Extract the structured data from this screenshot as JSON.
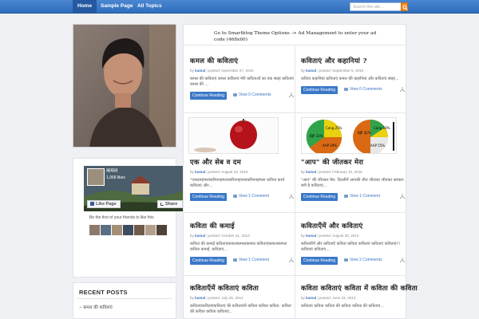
{
  "nav": {
    "items": [
      "Home",
      "Sample Page",
      "All Topics"
    ],
    "search_placeholder": "Search this site..."
  },
  "sidebar": {
    "facebook": {
      "page_name": "कमल",
      "likes": "1,068 likes",
      "like_button": "Like Page",
      "share_button": "Share",
      "friends_text": "Be the first of your friends to like this"
    },
    "recent_posts": {
      "title": "RECENT POSTS",
      "items": [
        "कमल की कविताएं"
      ]
    }
  },
  "main": {
    "ad_text": "Go to Smartblog Theme Options -> Ad Management to enter your ad code (468x60)",
    "continue_label": "Continue Reading",
    "posts": [
      {
        "title": "कमल की कविताएं",
        "author": "kamal",
        "posted": " | posted: November 27, 2015",
        "excerpt": "कमल की कविताएं कमल कविताएं मेरी कविताओं का एक संग्रह कविताएं कमल की ...",
        "comments": "View 0 Comments"
      },
      {
        "title": "कविताएं और कहानियां ?",
        "author": "kamal",
        "posted": " | posted: September 5, 2015",
        "excerpt": "कविता कहानियां कविताएं कमल की कहानियां और कविताएं संग्रह...",
        "comments": "View 0 Comments"
      },
      {
        "title": "एक और सेब व दम",
        "author": "kamal",
        "posted": " | posted: August 23, 2015",
        "excerpt": "\"एकदमहमलाकरियनहमलाकरियनहमलाकरियनहमला कविता करने कविताएं और...",
        "comments": "View 1 Comment"
      },
      {
        "title": "\"आप\" की जीतकर मेरा",
        "author": "kamal",
        "posted": " | posted: February 10, 2015",
        "excerpt": "\"आप\" की जीतकर मेरा. दिल्लीमें आपकी जीत जीतकर जीतकर सरकार बनी है कविताएं...",
        "comments": "View 1 Comment"
      },
      {
        "title": "कविता की कमाई",
        "author": "kamal",
        "posted": " | posted: October 31, 2014",
        "excerpt": "कविता की कमाई कविताएंकमालकमालकमाल कविताएंकमालकमाल कविता कमाई, कविताएं...",
        "comments": "View 1 Comment"
      },
      {
        "title": "कविताएँमें और कविताएं",
        "author": "kamal",
        "posted": " | posted: August 29, 2014",
        "excerpt": "कविताएँमें और कविताएँ कविता कविता कविताएं कविताएं कविताएं?! कविताएं कविताएं...",
        "comments": "View 2 Comments"
      },
      {
        "title": "कविताएँमें कविताएं कविता",
        "author": "kamal",
        "posted": " | posted: July 26, 2014",
        "excerpt": "कविताएंकविताएंकविताएं की कविताएंमें कविता कविता कविता. कविता की कविता कविता कविताएं..."
      },
      {
        "title": "कविता कविताएं कविता में कविता की कविता",
        "author": "kamal",
        "posted": " | posted: June 23, 2014",
        "excerpt": "कविताएं कविता कविता की कविता कविता की कविताएं..."
      }
    ],
    "charts": [
      {
        "label_a": "BJP 33%",
        "label_b": "AAP 29%",
        "label_c": "Cong 25%"
      },
      {
        "label_a": "BJP 32%",
        "label_b": "AAP 55%",
        "label_c": "Cong 10%"
      }
    ]
  },
  "colors": {
    "nav_blue": "#2f6ebd",
    "accent": "#3a78c8",
    "search_button": "#f08a24"
  }
}
